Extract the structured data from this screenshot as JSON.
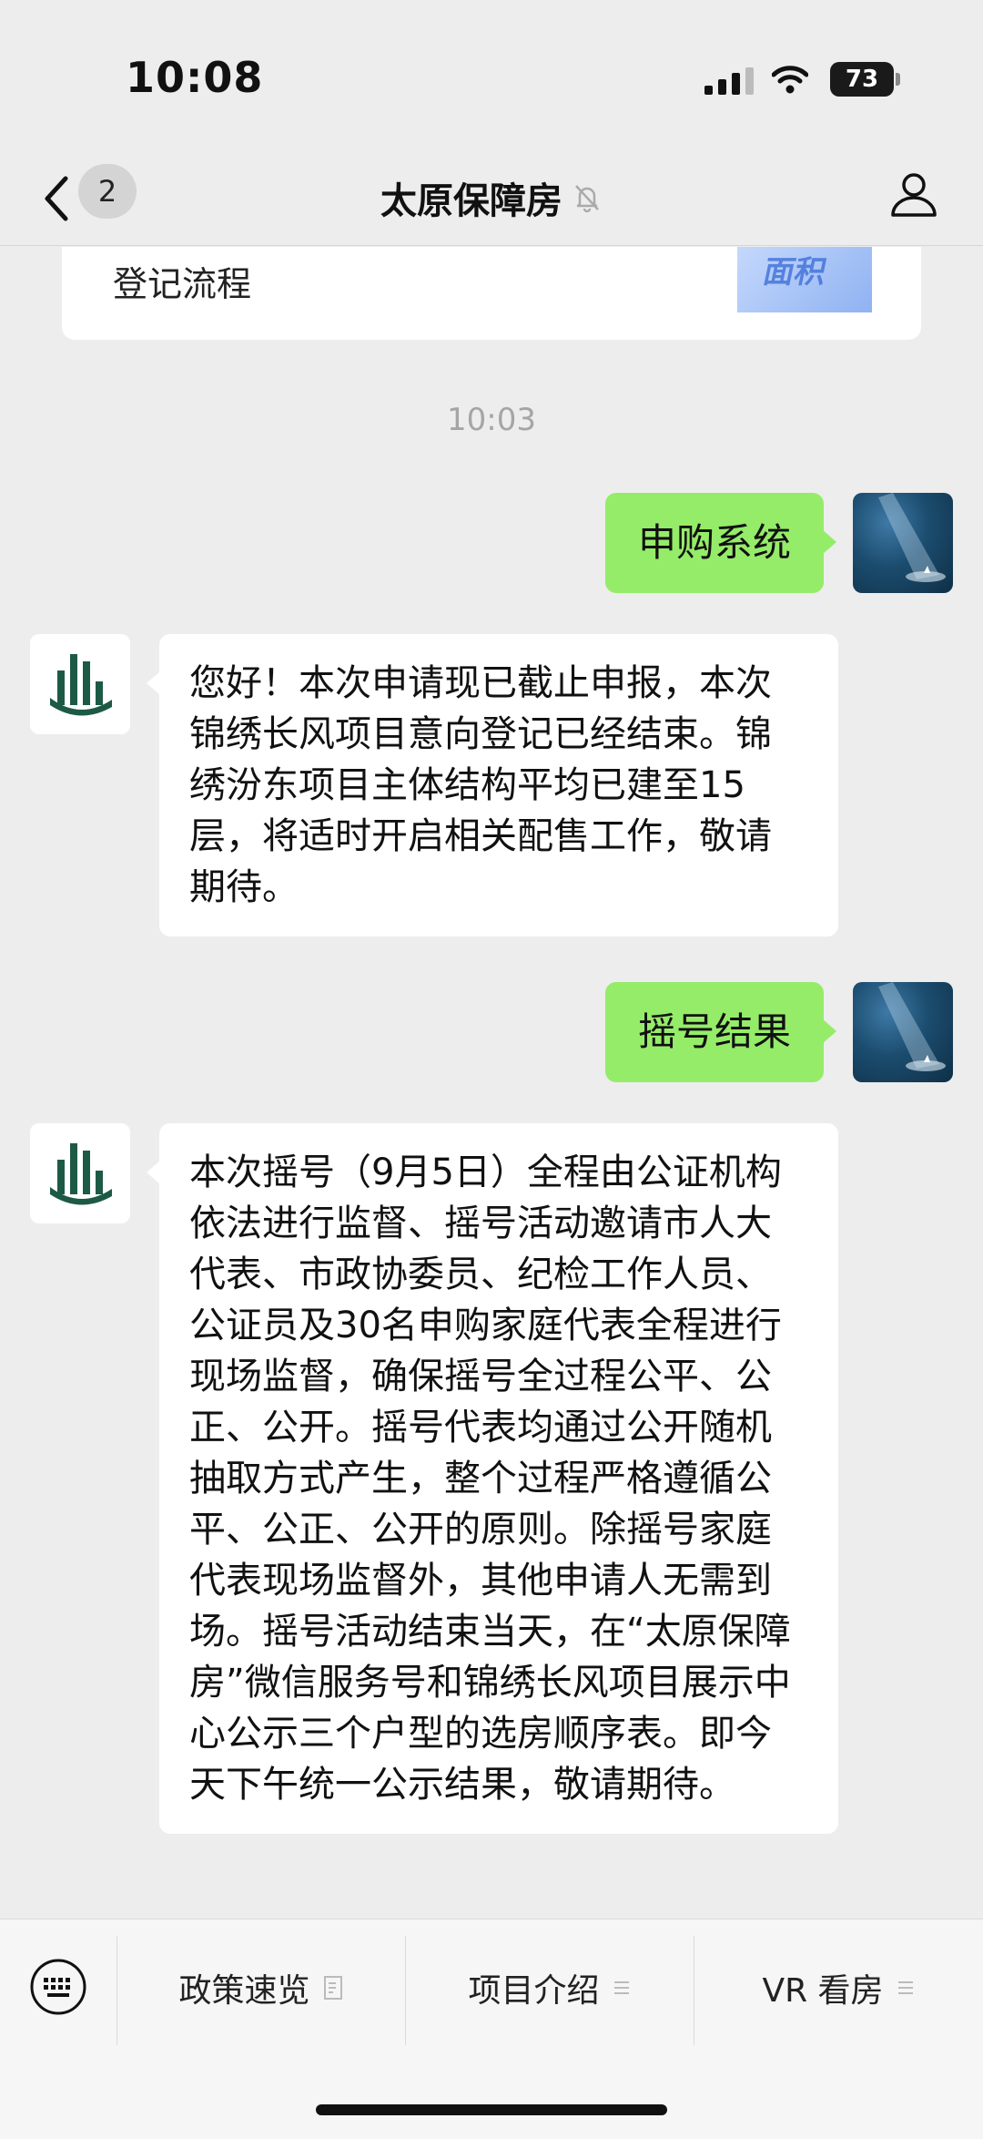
{
  "status_bar": {
    "time": "10:08",
    "battery": "73"
  },
  "nav": {
    "unread_count": "2",
    "title": "太原保障房"
  },
  "chat": {
    "card_title": "登记流程",
    "card_thumb_text": "面积",
    "timestamp": "10:03",
    "messages": [
      {
        "from": "user",
        "text": "申购系统"
      },
      {
        "from": "bot",
        "text": "您好！本次申请现已截止申报，本次锦绣长风项目意向登记已经结束。锦绣汾东项目主体结构平均已建至15层，将适时开启相关配售工作，敬请期待。"
      },
      {
        "from": "user",
        "text": "摇号结果"
      },
      {
        "from": "bot",
        "text": "本次摇号（9月5日）全程由公证机构依法进行监督、摇号活动邀请市人大代表、市政协委员、纪检工作人员、公证员及30名申购家庭代表全程进行现场监督，确保摇号全过程公平、公正、公开。摇号代表均通过公开随机抽取方式产生，整个过程严格遵循公平、公正、公开的原则。除摇号家庭代表现场监督外，其他申请人无需到场。摇号活动结束当天，在“太原保障房”微信服务号和锦绣长风项目展示中心公示三个户型的选房顺序表。即今天下午统一公示结果，敬请期待。"
      }
    ]
  },
  "menu": {
    "items": [
      {
        "label": "政策速览",
        "icon": "document-icon"
      },
      {
        "label": "项目介绍",
        "icon": "list-icon"
      },
      {
        "label": "VR 看房",
        "icon": "list-icon"
      }
    ]
  }
}
